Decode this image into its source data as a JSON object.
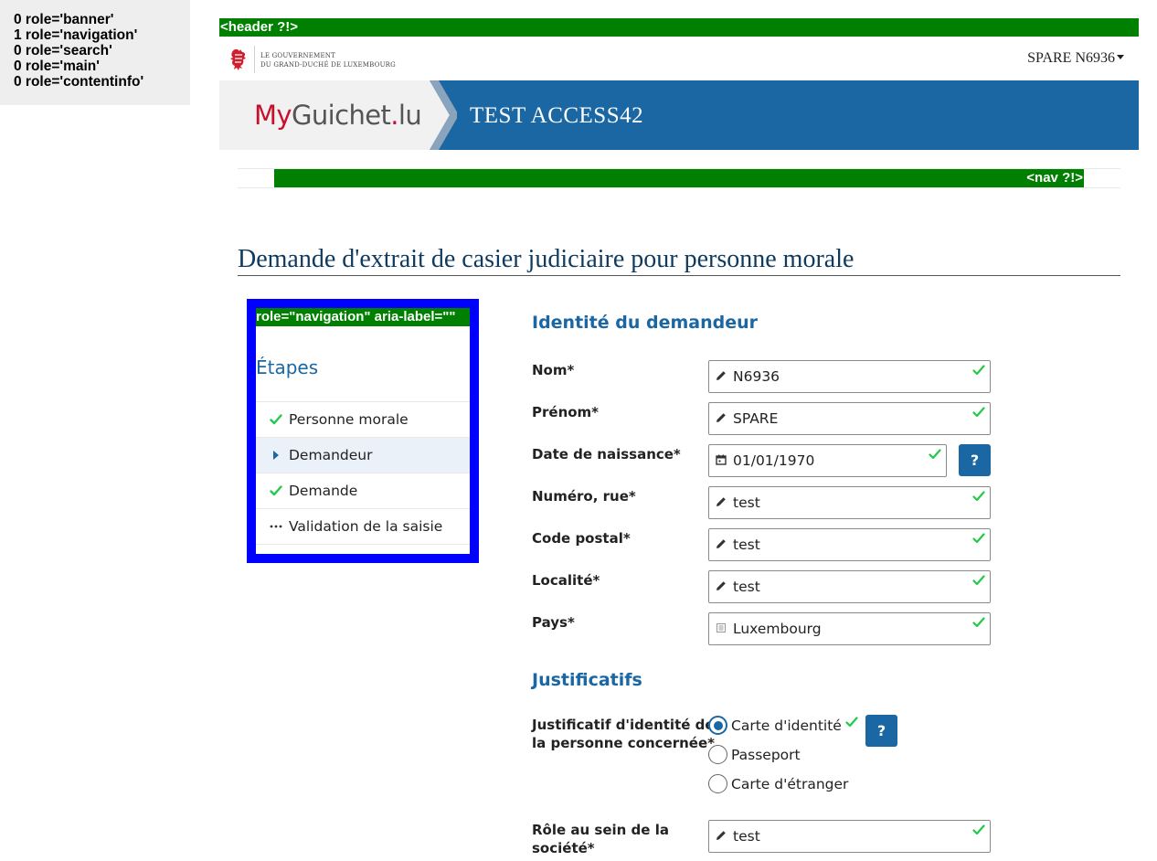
{
  "landmarks": [
    "0 role='banner'",
    "1 role='navigation'",
    "0 role='search'",
    "0 role='main'",
    "0 role='contentinfo'"
  ],
  "header_tag": "<header ?!>",
  "gov": {
    "line1": "LE GOUVERNEMENT",
    "line2": "DU GRAND-DUCHÉ DE LUXEMBOURG"
  },
  "user_menu": "SPARE N6936",
  "brand": {
    "my": "My",
    "guichet": "Guichet",
    "dot": ".",
    "lu": "lu",
    "title": "TEST ACCESS42"
  },
  "nav_tag": "<nav ?!>",
  "page_title": "Demande d'extrait de casier judiciaire pour personne morale",
  "steps": {
    "tag": "role=\"navigation\" aria-label=\"\"",
    "heading": "Étapes",
    "items": [
      {
        "label": "Personne morale",
        "icon": "check-icon"
      },
      {
        "label": "Demandeur",
        "icon": "caret-right-icon"
      },
      {
        "label": "Demande",
        "icon": "check-icon"
      },
      {
        "label": "Validation de la saisie",
        "icon": "ellipsis-icon"
      }
    ]
  },
  "identity": {
    "heading": "Identité du demandeur",
    "fields": [
      {
        "label": "Nom*",
        "value": "N6936",
        "icon": "pencil-icon"
      },
      {
        "label": "Prénom*",
        "value": "SPARE",
        "icon": "pencil-icon"
      },
      {
        "label": "Date de naissance*",
        "value": "01/01/1970",
        "icon": "calendar-icon"
      },
      {
        "label": "Numéro, rue*",
        "value": "test",
        "icon": "pencil-icon"
      },
      {
        "label": "Code postal*",
        "value": "test",
        "icon": "pencil-icon"
      },
      {
        "label": "Localité*",
        "value": "test",
        "icon": "pencil-icon"
      },
      {
        "label": "Pays*",
        "value": "Luxembourg",
        "icon": "list-icon"
      }
    ],
    "help_label": "?"
  },
  "justificatifs": {
    "heading": "Justificatifs",
    "id_label_line1": "Justificatif d'identité de",
    "id_label_line2": "la personne concernée*",
    "options": [
      "Carte d'identité",
      "Passeport",
      "Carte d'étranger"
    ],
    "selected": "Carte d'identité",
    "help_label": "?",
    "role_label_line1": "Rôle au sein de la",
    "role_label_line2": "société*",
    "role_value": "test"
  },
  "colors": {
    "primary_blue": "#1a67a3",
    "check_green": "#22c94a",
    "tag_green": "#008000",
    "focus_blue": "#0000ff"
  }
}
